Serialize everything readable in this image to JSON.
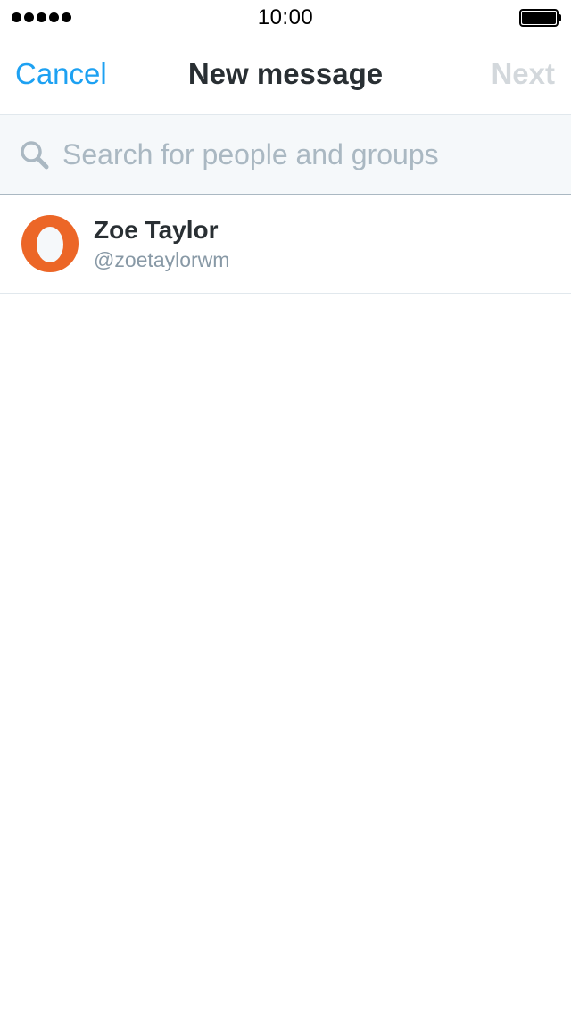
{
  "status_bar": {
    "time": "10:00",
    "signal_dots": 5,
    "battery_level": 1.0
  },
  "nav": {
    "cancel_label": "Cancel",
    "title": "New message",
    "next_label": "Next"
  },
  "search": {
    "placeholder": "Search for people and groups",
    "value": ""
  },
  "results": [
    {
      "name": "Zoe Taylor",
      "handle": "@zoetaylorwm",
      "avatar": "default-egg-avatar"
    }
  ],
  "colors": {
    "accent": "#1da1f2",
    "title": "#292f33",
    "disabled": "#d3d8dc",
    "secondary_text": "#8899a6",
    "avatar_orange": "#ec6627",
    "search_bg": "#f5f8fa"
  }
}
